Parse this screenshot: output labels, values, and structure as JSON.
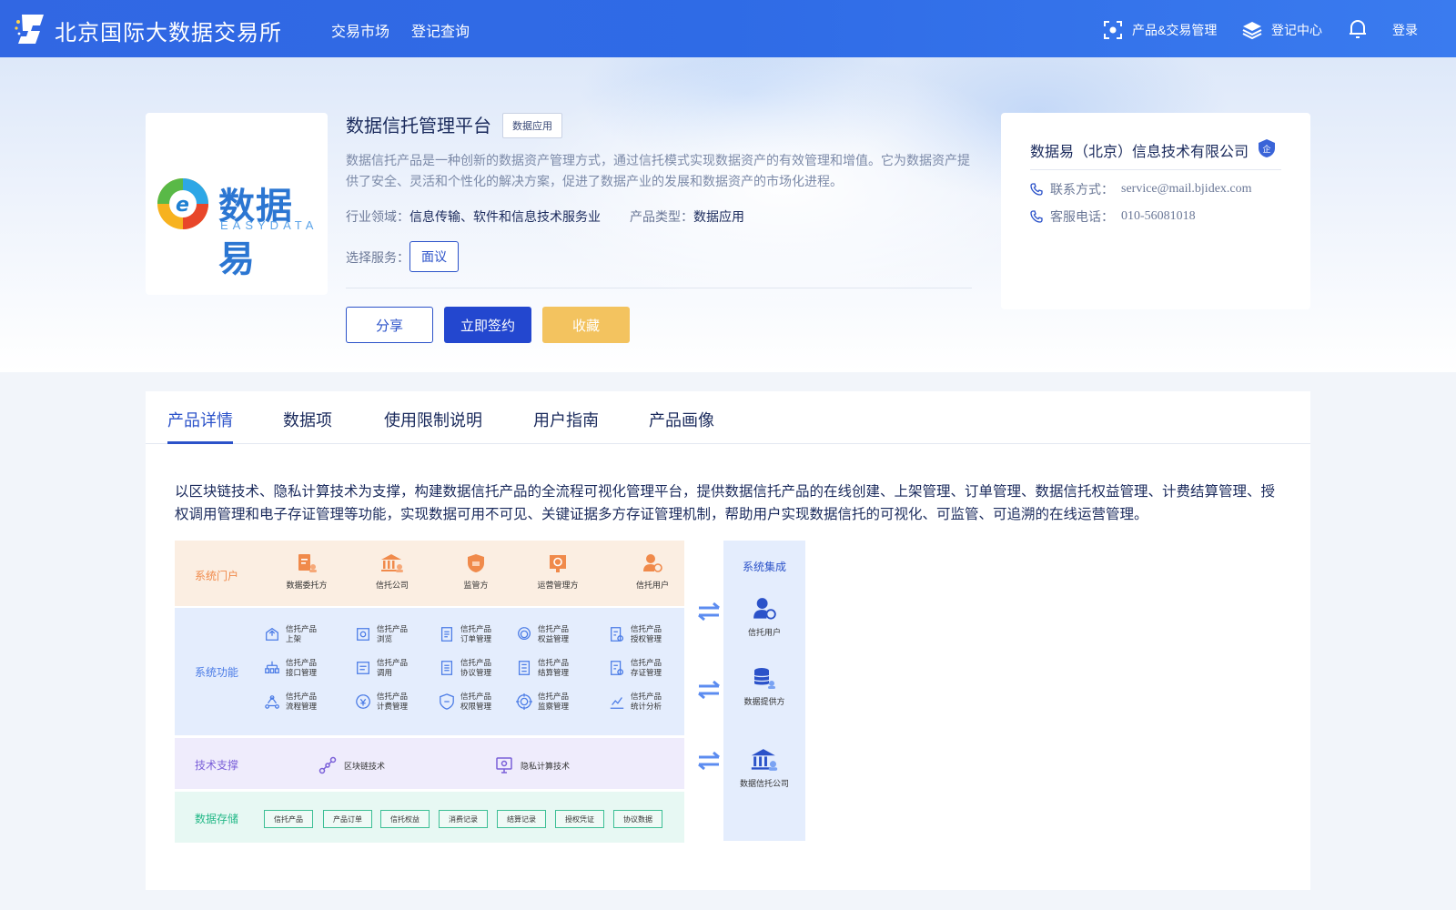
{
  "header": {
    "brand": "北京国际大数据交易所",
    "nav": [
      "交易市场",
      "登记查询"
    ],
    "right": {
      "product_mgmt": "产品&交易管理",
      "register_center": "登记中心",
      "login": "登录"
    }
  },
  "product": {
    "title": "数据信托管理平台",
    "tag": "数据应用",
    "description": "数据信托产品是一种创新的数据资产管理方式，通过信托模式实现数据资产的有效管理和增值。它为数据资产提供了安全、灵活和个性化的解决方案，促进了数据产业的发展和数据资产的市场化进程。",
    "industry_label": "行业领域：",
    "industry_value": "信息传输、软件和信息技术服务业",
    "type_label": "产品类型：",
    "type_value": "数据应用",
    "service_label": "选择服务：",
    "service_option": "面议",
    "buttons": {
      "share": "分享",
      "sign": "立即签约",
      "favorite": "收藏"
    },
    "logo": {
      "cn": "数据易",
      "en": "EASYDATA"
    }
  },
  "company": {
    "name": "数据易（北京）信息技术有限公司",
    "badge": "企",
    "contact_label": "联系方式：",
    "contact_value": "service@mail.bjidex.com",
    "phone_label": "客服电话：",
    "phone_value": "010-56081018"
  },
  "tabs": [
    "产品详情",
    "数据项",
    "使用限制说明",
    "用户指南",
    "产品画像"
  ],
  "intro": "以区块链技术、隐私计算技术为支撑，构建数据信托产品的全流程可视化管理平台，提供数据信托产品的在线创建、上架管理、订单管理、数据信托权益管理、计费结算管理、授权调用管理和电子存证管理等功能，实现数据可用不可见、关键证据多方存证管理机制，帮助用户实现数据信托的可视化、可监管、可追溯的在线运营管理。",
  "architecture": {
    "portal": {
      "name": "系统门户",
      "items": [
        "数据委托方",
        "信托公司",
        "监管方",
        "运营管理方",
        "信托用户"
      ]
    },
    "functions": {
      "name": "系统功能",
      "rows": [
        [
          [
            "信托产品",
            "上架"
          ],
          [
            "信托产品",
            "浏览"
          ],
          [
            "信托产品",
            "订单管理"
          ],
          [
            "信托产品",
            "权益管理"
          ],
          [
            "信托产品",
            "授权管理"
          ]
        ],
        [
          [
            "信托产品",
            "接口管理"
          ],
          [
            "信托产品",
            "调用"
          ],
          [
            "信托产品",
            "协议管理"
          ],
          [
            "信托产品",
            "结算管理"
          ],
          [
            "信托产品",
            "存证管理"
          ]
        ],
        [
          [
            "信托产品",
            "流程管理"
          ],
          [
            "信托产品",
            "计费管理"
          ],
          [
            "信托产品",
            "权限管理"
          ],
          [
            "信托产品",
            "监察管理"
          ],
          [
            "信托产品",
            "统计分析"
          ]
        ]
      ]
    },
    "tech": {
      "name": "技术支撑",
      "items": [
        "区块链技术",
        "隐私计算技术"
      ]
    },
    "storage": {
      "name": "数据存储",
      "items": [
        "信托产品",
        "产品订单",
        "信托权益",
        "消费记录",
        "结算记录",
        "授权凭证",
        "协议数据"
      ]
    },
    "integration": {
      "name": "系统集成",
      "items": [
        "信托用户",
        "数据提供方",
        "数据信托公司"
      ]
    }
  },
  "colors": {
    "primary": "#2b52c9",
    "nav_bg": "#3167e3",
    "favorite": "#f3c35f",
    "portal": "#f08a4b",
    "func": "#4a7be6",
    "tech": "#7a5fd8",
    "storage": "#23b887"
  }
}
